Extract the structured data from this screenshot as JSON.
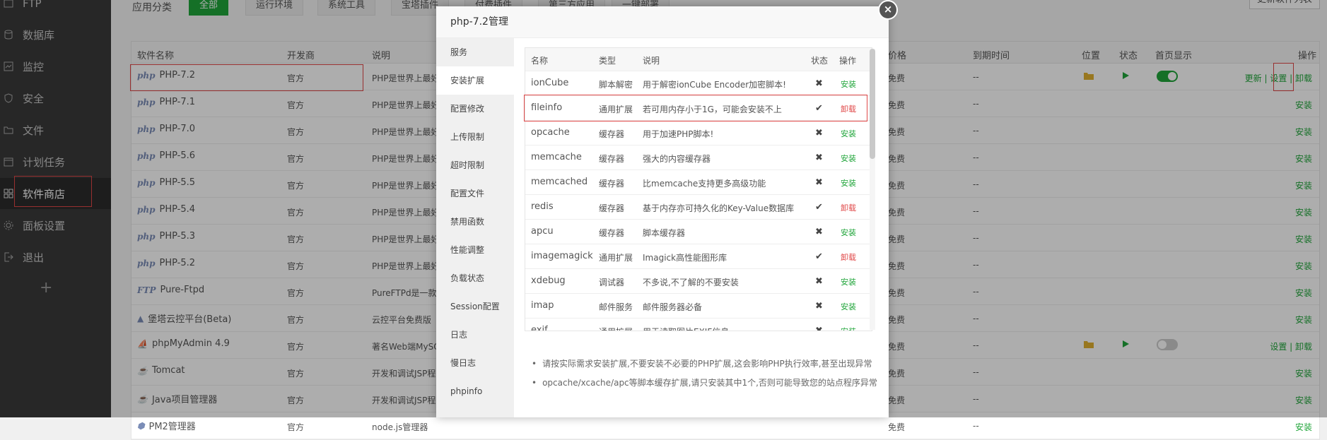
{
  "sidebar": {
    "items": [
      {
        "label": "FTP",
        "icon": "ftp-icon"
      },
      {
        "label": "数据库",
        "icon": "database-icon"
      },
      {
        "label": "监控",
        "icon": "monitor-icon"
      },
      {
        "label": "安全",
        "icon": "shield-icon"
      },
      {
        "label": "文件",
        "icon": "folder-icon"
      },
      {
        "label": "计划任务",
        "icon": "calendar-icon"
      },
      {
        "label": "软件商店",
        "icon": "apps-grid-icon",
        "active": true
      },
      {
        "label": "面板设置",
        "icon": "gear-icon"
      },
      {
        "label": "退出",
        "icon": "logout-icon"
      }
    ],
    "add_label": "+"
  },
  "catbar": {
    "label": "应用分类",
    "buttons": [
      "全部",
      "运行环境",
      "系统工具",
      "宝塔插件",
      "付费插件",
      "第三方应用",
      "一键部署"
    ],
    "refresh_label": "更新软件列表"
  },
  "table": {
    "headers": [
      "软件名称",
      "开发商",
      "说明",
      "价格",
      "到期时间",
      "位置",
      "状态",
      "首页显示",
      "操作"
    ],
    "rows": [
      {
        "logo": "php",
        "name": "PHP-7.2",
        "dev": "官方",
        "desc": "PHP是世界上最好",
        "price": "免费",
        "expire": "--",
        "ops": "更新 | 设置 | 卸载"
      },
      {
        "logo": "php",
        "name": "PHP-7.1",
        "dev": "官方",
        "desc": "PHP是世界上最好",
        "price": "免费",
        "expire": "--",
        "ops": "安装"
      },
      {
        "logo": "php",
        "name": "PHP-7.0",
        "dev": "官方",
        "desc": "PHP是世界上最好",
        "price": "免费",
        "expire": "--",
        "ops": "安装"
      },
      {
        "logo": "php",
        "name": "PHP-5.6",
        "dev": "官方",
        "desc": "PHP是世界上最好",
        "price": "免费",
        "expire": "--",
        "ops": "安装"
      },
      {
        "logo": "php",
        "name": "PHP-5.5",
        "dev": "官方",
        "desc": "PHP是世界上最好",
        "price": "免费",
        "expire": "--",
        "ops": "安装"
      },
      {
        "logo": "php",
        "name": "PHP-5.4",
        "dev": "官方",
        "desc": "PHP是世界上最好",
        "price": "免费",
        "expire": "--",
        "ops": "安装"
      },
      {
        "logo": "php",
        "name": "PHP-5.3",
        "dev": "官方",
        "desc": "PHP是世界上最好",
        "price": "免费",
        "expire": "--",
        "ops": "安装"
      },
      {
        "logo": "php",
        "name": "PHP-5.2",
        "dev": "官方",
        "desc": "PHP是世界上最好",
        "price": "免费",
        "expire": "--",
        "ops": "安装"
      },
      {
        "logo": "FTP",
        "name": "Pure-Ftpd",
        "dev": "官方",
        "desc": "PureFTPd是一款",
        "price": "免费",
        "expire": "--",
        "ops": "安装"
      },
      {
        "logo": "▲",
        "name": "堡塔云控平台(Beta)",
        "dev": "官方",
        "desc": "云控平台免费版",
        "price": "免费",
        "expire": "--",
        "ops": "安装"
      },
      {
        "logo": "⛵",
        "name": "phpMyAdmin 4.9",
        "dev": "官方",
        "desc": "著名Web端MySQ",
        "price": "免费",
        "expire": "--",
        "ops": "设置 | 卸载"
      },
      {
        "logo": "☕",
        "name": "Tomcat",
        "dev": "官方",
        "desc": "开发和调试JSP程",
        "price": "免费",
        "expire": "--",
        "ops": "安装"
      },
      {
        "logo": "☕",
        "name": "Java项目管理器",
        "dev": "官方",
        "desc": "开发和调试JSP程",
        "price": "免费",
        "expire": "--",
        "ops": "安装"
      },
      {
        "logo": "⬢",
        "name": "PM2管理器",
        "dev": "官方",
        "desc": "node.js管理器",
        "price": "免费",
        "expire": "--",
        "ops": "安装"
      }
    ]
  },
  "modal": {
    "title": "php-7.2管理",
    "close": "×",
    "menu": [
      "服务",
      "安装扩展",
      "配置修改",
      "上传限制",
      "超时限制",
      "配置文件",
      "禁用函数",
      "性能调整",
      "负载状态",
      "Session配置",
      "日志",
      "慢日志",
      "phpinfo"
    ],
    "ext_headers": [
      "名称",
      "类型",
      "说明",
      "状态",
      "操作"
    ],
    "extensions": [
      {
        "name": "ionCube",
        "type": "脚本解密",
        "desc": "用于解密ionCube Encoder加密脚本!",
        "status": "✖",
        "op": "安装",
        "installed": false
      },
      {
        "name": "fileinfo",
        "type": "通用扩展",
        "desc": "若可用内存小于1G，可能会安装不上",
        "status": "✔",
        "op": "卸载",
        "installed": true
      },
      {
        "name": "opcache",
        "type": "缓存器",
        "desc": "用于加速PHP脚本!",
        "status": "✖",
        "op": "安装",
        "installed": false
      },
      {
        "name": "memcache",
        "type": "缓存器",
        "desc": "强大的内容缓存器",
        "status": "✖",
        "op": "安装",
        "installed": false
      },
      {
        "name": "memcached",
        "type": "缓存器",
        "desc": "比memcache支持更多高级功能",
        "status": "✖",
        "op": "安装",
        "installed": false
      },
      {
        "name": "redis",
        "type": "缓存器",
        "desc": "基于内存亦可持久化的Key-Value数据库",
        "status": "✔",
        "op": "卸载",
        "installed": true
      },
      {
        "name": "apcu",
        "type": "缓存器",
        "desc": "脚本缓存器",
        "status": "✖",
        "op": "安装",
        "installed": false
      },
      {
        "name": "imagemagick",
        "type": "通用扩展",
        "desc": "Imagick高性能图形库",
        "status": "✔",
        "op": "卸载",
        "installed": true
      },
      {
        "name": "xdebug",
        "type": "调试器",
        "desc": "不多说,不了解的不要安装",
        "status": "✖",
        "op": "安装",
        "installed": false
      },
      {
        "name": "imap",
        "type": "邮件服务",
        "desc": "邮件服务器必备",
        "status": "✖",
        "op": "安装",
        "installed": false
      },
      {
        "name": "exif",
        "type": "通用扩展",
        "desc": "用于读取图片EXIF信息",
        "status": "✖",
        "op": "安装",
        "installed": false
      }
    ],
    "notes": [
      "请按实际需求安装扩展,不要安装不必要的PHP扩展,这会影响PHP执行效率,甚至出现异常",
      "opcache/xcache/apc等脚本缓存扩展,请只安装其中1个,否则可能导致您的站点程序异常"
    ]
  },
  "colors": {
    "accent": "#20a53a",
    "danger": "#e04848",
    "sidebar": "#3a3a3a"
  }
}
